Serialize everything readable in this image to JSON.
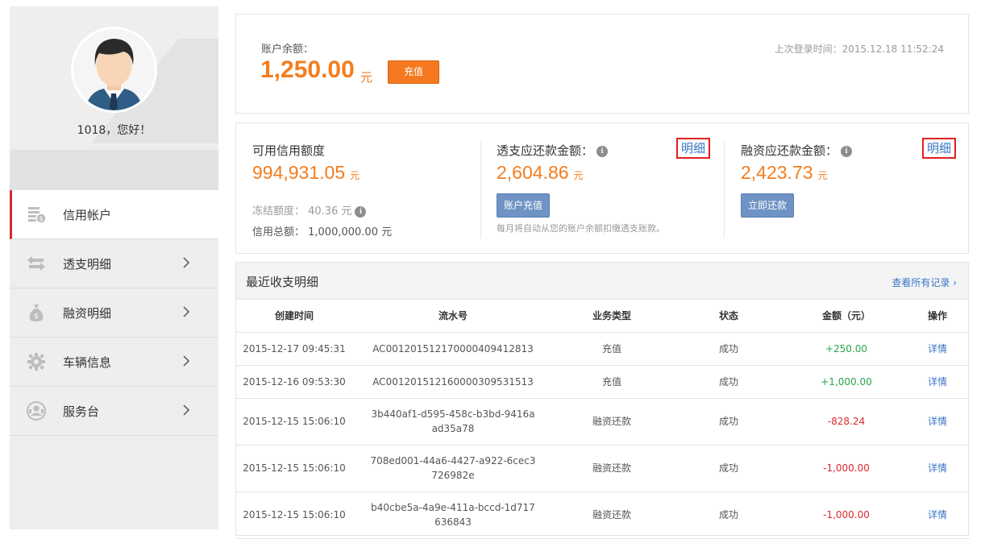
{
  "sidebar": {
    "greeting": "1018，您好！",
    "items": [
      {
        "label": "信用帐户",
        "icon": "coins-icon",
        "active": true
      },
      {
        "label": "透支明细",
        "icon": "transfer-arrows-icon",
        "active": false
      },
      {
        "label": "融资明细",
        "icon": "money-bag-icon",
        "active": false
      },
      {
        "label": "车辆信息",
        "icon": "gear-icon",
        "active": false
      },
      {
        "label": "服务台",
        "icon": "service-person-icon",
        "active": false
      }
    ]
  },
  "balance": {
    "label": "账户余额：",
    "amount": "1,250.00",
    "unit": "元",
    "recharge_button": "充值",
    "last_login": "上次登录时间：2015.12.18 11:52:24"
  },
  "credit": {
    "available": {
      "title": "可用信用额度",
      "amount": "994,931.05",
      "unit": "元",
      "frozen": "冻结额度： 40.36 元",
      "total": "信用总额： 1,000,000.00 元"
    },
    "overdraft": {
      "title": "透支应还款金额：",
      "amount": "2,604.86",
      "unit": "元",
      "detail": "明细",
      "button": "账户充值",
      "note": "每月将自动从您的账户余额扣缴透支账款。"
    },
    "financing": {
      "title": "融资应还款金额：",
      "amount": "2,423.73",
      "unit": "元",
      "detail": "明细",
      "button": "立即还款"
    }
  },
  "records": {
    "title": "最近收支明细",
    "view_all": "查看所有记录 ›",
    "columns": [
      "创建时间",
      "流水号",
      "业务类型",
      "状态",
      "金额（元）",
      "操作"
    ],
    "rows": [
      {
        "time": "2015-12-17 09:45:31",
        "serial": "AC00120151217000040941281​3",
        "type": "充值",
        "status": "成功",
        "amount": "+250.00",
        "sign": "pos",
        "action": "详情"
      },
      {
        "time": "2015-12-16 09:53:30",
        "serial": "AC00120151216000030953151​3",
        "type": "充值",
        "status": "成功",
        "amount": "+1,000.00",
        "sign": "pos",
        "action": "详情"
      },
      {
        "time": "2015-12-15 15:06:10",
        "serial": "3b440af1-d595-458c-b3bd-9416aad35a78",
        "type": "融资还款",
        "status": "成功",
        "amount": "-828.24",
        "sign": "neg",
        "action": "详情"
      },
      {
        "time": "2015-12-15 15:06:10",
        "serial": "708ed001-44a6-4427-a922-6cec3726982e",
        "type": "融资还款",
        "status": "成功",
        "amount": "-1,000.00",
        "sign": "neg",
        "action": "详情"
      },
      {
        "time": "2015-12-15 15:06:10",
        "serial": "b40cbe5a-4a9e-411a-bccd-1d717636843",
        "type": "融资还款",
        "status": "成功",
        "amount": "-1,000.00",
        "sign": "neg",
        "action": "详情"
      }
    ]
  },
  "colors": {
    "accent_orange": "#f37d1e",
    "link_blue": "#3a75c4",
    "active_red": "#d9292f",
    "positive_green": "#2aa34a"
  }
}
